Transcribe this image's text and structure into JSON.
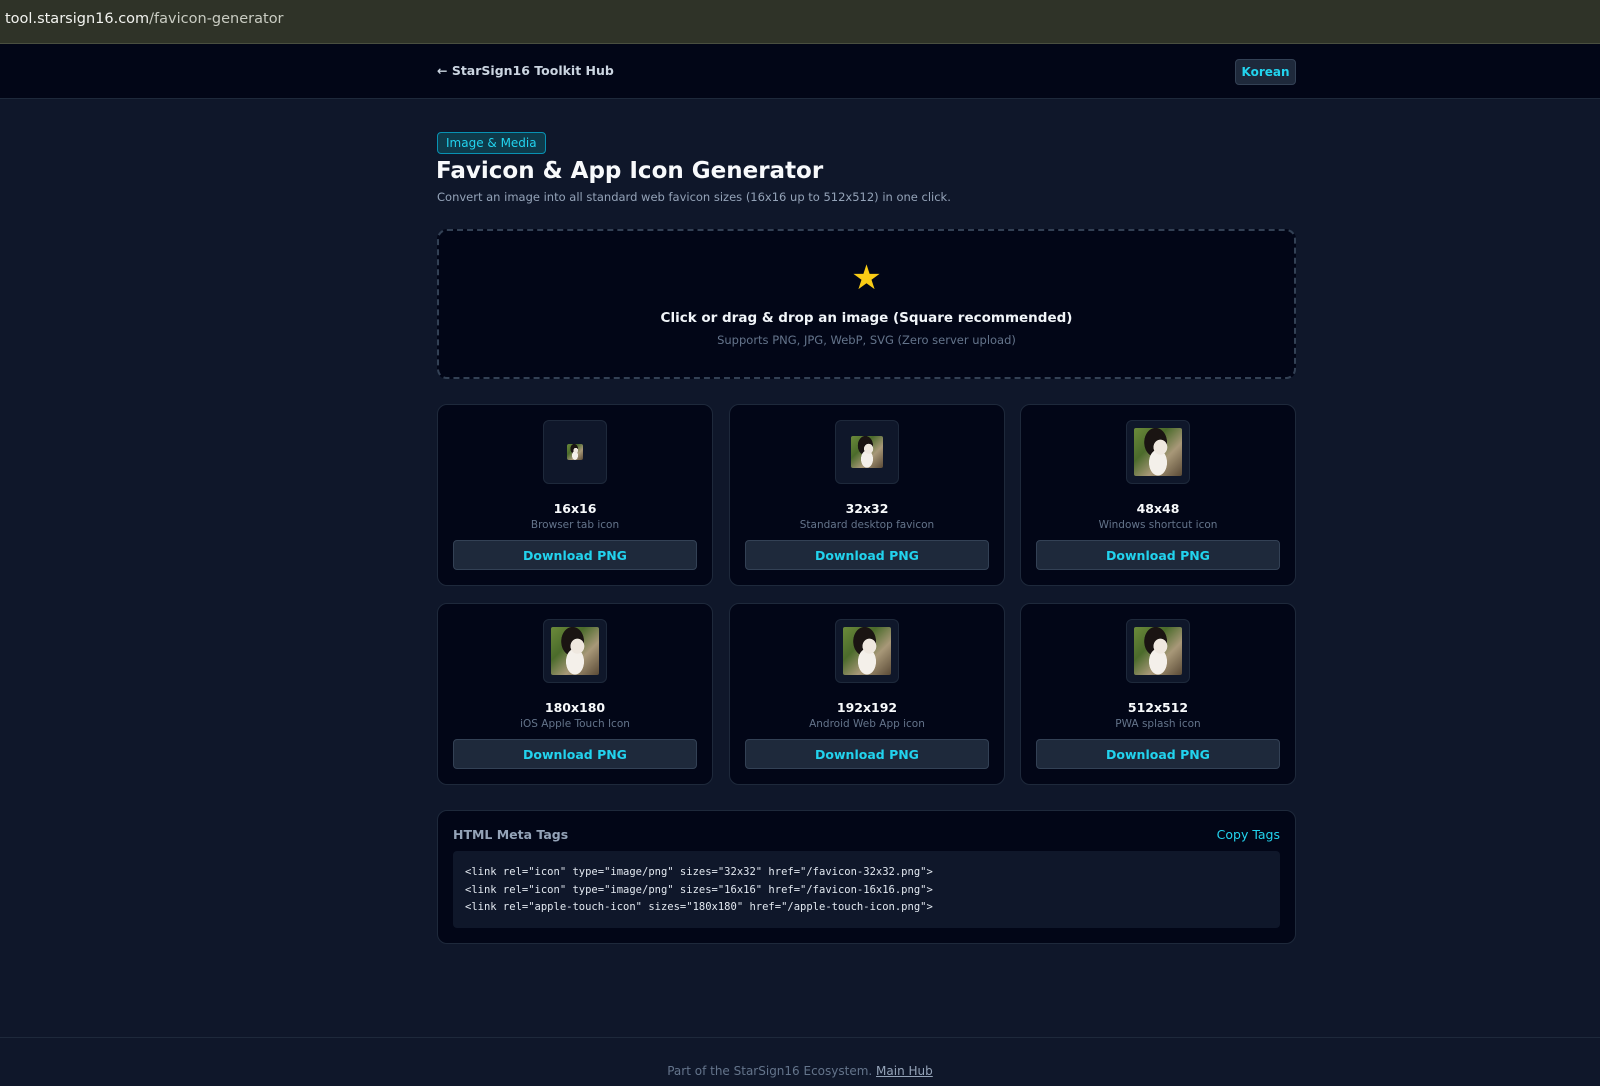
{
  "browser": {
    "url_host": "tool.starsign16.com",
    "url_path": "/favicon-generator"
  },
  "nav": {
    "back_label": "← StarSign16 Toolkit Hub",
    "lang_label": "Korean"
  },
  "header": {
    "category": "Image & Media",
    "title": "Favicon & App Icon Generator",
    "subtitle": "Convert an image into all standard web favicon sizes (16x16 up to 512x512) in one click."
  },
  "dropzone": {
    "icon": "star-icon",
    "icon_glyph": "★",
    "title": "Click or drag & drop an image (Square recommended)",
    "hint": "Supports PNG, JPG, WebP, SVG (Zero server upload)"
  },
  "icons": [
    {
      "size": "16x16",
      "desc": "Browser tab icon",
      "button": "Download PNG"
    },
    {
      "size": "32x32",
      "desc": "Standard desktop favicon",
      "button": "Download PNG"
    },
    {
      "size": "48x48",
      "desc": "Windows shortcut icon",
      "button": "Download PNG"
    },
    {
      "size": "180x180",
      "desc": "iOS Apple Touch Icon",
      "button": "Download PNG"
    },
    {
      "size": "192x192",
      "desc": "Android Web App icon",
      "button": "Download PNG"
    },
    {
      "size": "512x512",
      "desc": "PWA splash icon",
      "button": "Download PNG"
    }
  ],
  "meta": {
    "title": "HTML Meta Tags",
    "copy_label": "Copy Tags",
    "code_lines": [
      "<link rel=\"icon\" type=\"image/png\" sizes=\"32x32\" href=\"/favicon-32x32.png\">",
      "<link rel=\"icon\" type=\"image/png\" sizes=\"16x16\" href=\"/favicon-16x16.png\">",
      "<link rel=\"apple-touch-icon\" sizes=\"180x180\" href=\"/apple-touch-icon.png\">"
    ]
  },
  "footer": {
    "text": "Part of the StarSign16 Ecosystem.",
    "link": "Main Hub"
  },
  "colors": {
    "background": "#0f172a",
    "accent": "#22d3ee",
    "star": "#facc15"
  }
}
